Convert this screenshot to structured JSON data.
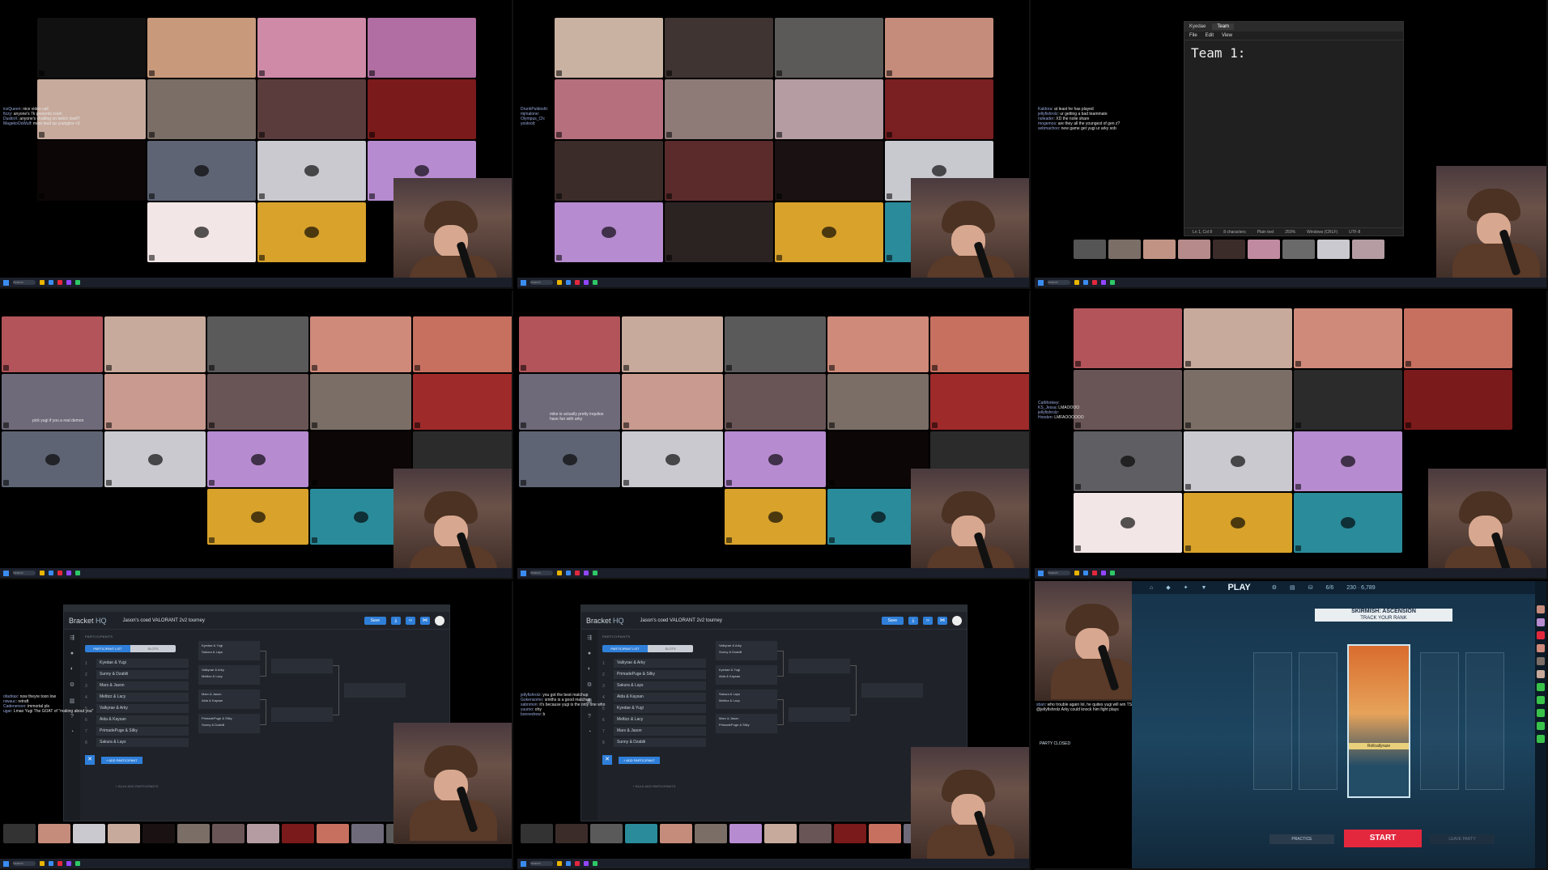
{
  "colors": {
    "tiles_p1": [
      "#111",
      "#c89a7b",
      "#cf8aa8",
      "#b06ea2",
      "#c7aa9c",
      "#7b6e66",
      "#5b3c3c",
      "#7a1a1a",
      "#0d0606",
      "#5e6473",
      "#c9c9cf",
      "#b78bd0",
      "#000",
      "#f3e6e6",
      "#d8a22b",
      "#000"
    ],
    "tiles_p2": [
      "#c9b2a2",
      "#3f3432",
      "#5c5a58",
      "#c58c7c",
      "#b6707d",
      "#8e7b78",
      "#b49ca2",
      "#7a1f22",
      "#3b2c2a",
      "#5a2b2a",
      "#1a1212",
      "#c8c8cf",
      "#b78bd0",
      "#2b2322",
      "#d8a22b",
      "#2a8b9a"
    ],
    "tiles_p4": [
      "#b2545a",
      "#c7aa9c",
      "#5a5a5a",
      "#d08a7a",
      "#c7705f",
      "#6e6a7a",
      "#c99a8f",
      "#6a5556",
      "#7a6e66",
      "#9e2a2a",
      "#5e6473",
      "#c9c9cf",
      "#b78bd0",
      "#0d0606",
      "#2b2b2b",
      "#000",
      "#000",
      "#d8a22b",
      "#2a8b9a",
      "#000"
    ],
    "tiles_p6": [
      "#b2545a",
      "#c7aa9c",
      "#d08a7a",
      "#c7705f",
      "#6a5556",
      "#7a6e66",
      "#2b2b2b",
      "#7a1a1a",
      "#5e5e63",
      "#c9c9cf",
      "#b78bd0",
      "#000",
      "#f3e6e6",
      "#d8a22b",
      "#2a8b9a",
      "#000"
    ],
    "strip_p3": [
      "#555",
      "#7a6e66",
      "#c09384",
      "#b68a8a",
      "#3b2c2a",
      "#c08aa0",
      "#6a6a6a",
      "#c9c9cf",
      "#b49ca2"
    ],
    "strip_p7": [
      "#333",
      "#c58c7c",
      "#c9c9cf",
      "#c7aa9c",
      "#1a1212",
      "#7a6e66",
      "#6a5556",
      "#b49ca2",
      "#7a1a1a",
      "#c7705f",
      "#6e6a7a",
      "#5a5a5a",
      "#7a1f22"
    ],
    "strip_p8": [
      "#333",
      "#3b2c2a",
      "#5a5a5a",
      "#2a8b9a",
      "#c58c7c",
      "#7a6e66",
      "#b78bd0",
      "#c7aa9c",
      "#6a5556",
      "#7a1a1a",
      "#c7705f",
      "#6e6a7a"
    ],
    "brand_blue": "#2f7fd9",
    "valorant_red": "#e3283e"
  },
  "taskbar": {
    "search": "Search"
  },
  "chats": {
    "p1": [
      {
        "user": "iceQueen",
        "msg": "nice video call"
      },
      {
        "user": "fizzy",
        "msg": "anyone's 7k presents room"
      },
      {
        "user": "DustinX",
        "msg": "anyone's chatting on twitch itself?"
      },
      {
        "user": "MagekoOsWulf",
        "msg": "more lead up youngins <3"
      }
    ],
    "p2": [
      {
        "user": "DrunkPuldoshi",
        "msg": ""
      },
      {
        "user": "mjmalone",
        "msg": ""
      },
      {
        "user": "Olympus_Ch",
        "msg": ""
      },
      {
        "user": "yoolooli",
        "msg": ""
      }
    ],
    "p3": [
      {
        "user": "Kaldora",
        "msg": "at least he has played"
      },
      {
        "user": "jellyfishrolz",
        "msg": "ur getting a bad teammate"
      },
      {
        "user": "noleader",
        "msg": "XD the nolie share"
      },
      {
        "user": "mogemos",
        "msg": "are they all the youngest of gen z?"
      },
      {
        "user": "sebmachoo",
        "msg": "new game get yugi ur arky sob"
      }
    ],
    "p4": [
      {
        "user": "",
        "msg": "pick yugi if you a real demon"
      }
    ],
    "p5": [
      {
        "user": "",
        "msg": "mike is actually pretty inquitos"
      },
      {
        "user": "",
        "msg": "have fun with arky"
      }
    ],
    "p6": [
      {
        "user": "CatMonkey",
        "msg": ""
      },
      {
        "user": "KS_Jessa",
        "msg": "LMAOOOO"
      },
      {
        "user": "jellyfishrolz",
        "msg": ""
      },
      {
        "user": "Hooden",
        "msg": "LMFAOOOOOO"
      }
    ],
    "p7": [
      {
        "user": "ofadriax",
        "msg": "now theyre toon low"
      },
      {
        "user": "niwauc",
        "msg": "retraft"
      },
      {
        "user": "Cadenerson",
        "msg": "immortal pls"
      },
      {
        "user": "ugar",
        "msg": "Lmao Yugi The GOAT of \"making about you\""
      }
    ],
    "p8": [
      {
        "user": "jellyfishrolz",
        "msg": "you got the best matchup"
      },
      {
        "user": "Gokensomo",
        "msg": "smiths is a good matchup"
      },
      {
        "user": "sabnmon",
        "msg": "it's because yugi is the only one who"
      },
      {
        "user": "yuumo",
        "msg": "ohy"
      },
      {
        "user": "bonnedrew",
        "msg": "b"
      }
    ],
    "p9": [
      {
        "user": "sban",
        "msg": "who trouble again lol, he quites yugi will win TSHS TSHS"
      },
      {
        "user": "",
        "msg": "@jellyfishrolz Arky could knock him fight plays"
      }
    ]
  },
  "notepad": {
    "tab_inactive": "Kyedae",
    "tab_active": "Team",
    "menu": [
      "File",
      "Edit",
      "View"
    ],
    "text": "Team 1:",
    "status": [
      "Ln 1, Col 8",
      "8 characters",
      "Plain text",
      "250%",
      "Windows (CRLF)",
      "UTF-8"
    ]
  },
  "bracket": {
    "logo": "Bracket",
    "logo_suffix": "HQ",
    "event": "Jason's coed VALORANT 2v2 tourney",
    "save": "Save",
    "section_label": "PARTICIPANTS",
    "seg_on": "PARTICIPANT LIST",
    "seg_off": "SLOTS",
    "add": "+ ADD PARTICIPANT",
    "bulk": "+ BULK ADD PARTICIPANTS",
    "participants_a": [
      "Kyedae & Yugi",
      "Sunny & Dzabili",
      "Mars & Jason",
      "Meltizz & Lacy",
      "Valkyrae & Arky",
      "Aida & Kaysan",
      "PrimadePuge & Silky",
      "Sakura & Lays"
    ],
    "participants_b": [
      "Valkyrae & Arky",
      "PrimadePuge & Silky",
      "Sakura & Lays",
      "Aida & Kaysan",
      "Kyedae & Yugi",
      "Meltizz & Lacy",
      "Marx & Jason",
      "Sunny & Dzabili"
    ],
    "round1_a": [
      [
        "Kyedae & Yugi",
        "Sakura & Lays"
      ],
      [
        "Valkyrae & Arky",
        "Meltizz & Lacy"
      ],
      [
        "Marx & Jason",
        "Aida & Kaysan"
      ],
      [
        "PrimadePuge & Silky",
        "Sunny & Dzabili"
      ]
    ],
    "round1_b": [
      [
        "Valkyrae & Arky",
        "Sunny & Dzabili"
      ],
      [
        "Kyedae & Yugi",
        "Aida & Kaysan"
      ],
      [
        "Sakura & Lays",
        "Meltizz & Lacy"
      ],
      [
        "Marx & Jason",
        "PrimadePuge & Silky"
      ]
    ]
  },
  "valorant": {
    "play": "PLAY",
    "mode_title": "SKIRMISH: ASCENSION",
    "mode_sub": "TRACK YOUR RANK",
    "agent": "Rollcallyraze",
    "party_closed": "PARTY CLOSED",
    "practice": "PRACTICE",
    "start": "START",
    "leave": "LEAVE PARTY",
    "level": "6/6",
    "currency": "230 · 6,789"
  }
}
